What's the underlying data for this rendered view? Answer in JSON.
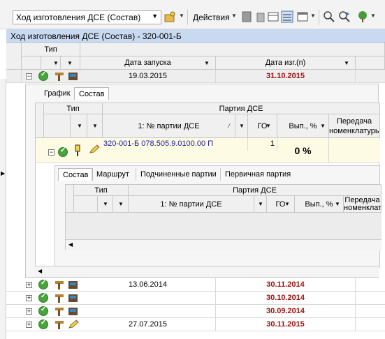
{
  "toolbar": {
    "view_select": "Ход изготовления ДСЕ (Состав)",
    "actions_label": "Действия"
  },
  "title": "Ход изготовления ДСЕ (Состав) - 320-001-Б",
  "grid": {
    "group_header": "Тип",
    "col_start": "Дата запуска",
    "col_made": "Дата изг.(п)",
    "rows": [
      {
        "start": "19.03.2015",
        "made": "31.10.2015"
      },
      {
        "start": "13.06.2014",
        "made": "30.11.2014"
      },
      {
        "start": "",
        "made": "30.10.2014"
      },
      {
        "start": "",
        "made": "30.09.2014"
      },
      {
        "start": "27.07.2015",
        "made": "30.11.2015"
      }
    ]
  },
  "detail": {
    "tabs": [
      "График",
      "Состав"
    ],
    "active_tab": "Состав",
    "type_header": "Тип",
    "party_header": "Партия ДСЕ",
    "col_party_no": "1: № партии ДСЕ",
    "col_go": "ГО",
    "col_done": "Вып., %",
    "col_transfer": "Передача номенклатуры",
    "row": {
      "party": "320-001-Б 078.505.9.0100.00 П",
      "go": "1",
      "done": "0 %"
    },
    "sub_tabs": [
      "Состав",
      "Маршрут",
      "Подчиненные партии",
      "Первичная партия"
    ],
    "sub_active": "Состав",
    "sub_type_header": "Тип",
    "sub_party_header": "Партия ДСЕ",
    "sub_col_party_no": "1: № партии ДСЕ",
    "sub_col_go": "ГО",
    "sub_col_done": "Вып., %",
    "sub_col_transfer": "Передача номенклатуры"
  },
  "colors": {
    "title_bg": "#c9daf0",
    "date_red": "#a01010",
    "accent_yellow": "#fdfbe3"
  }
}
